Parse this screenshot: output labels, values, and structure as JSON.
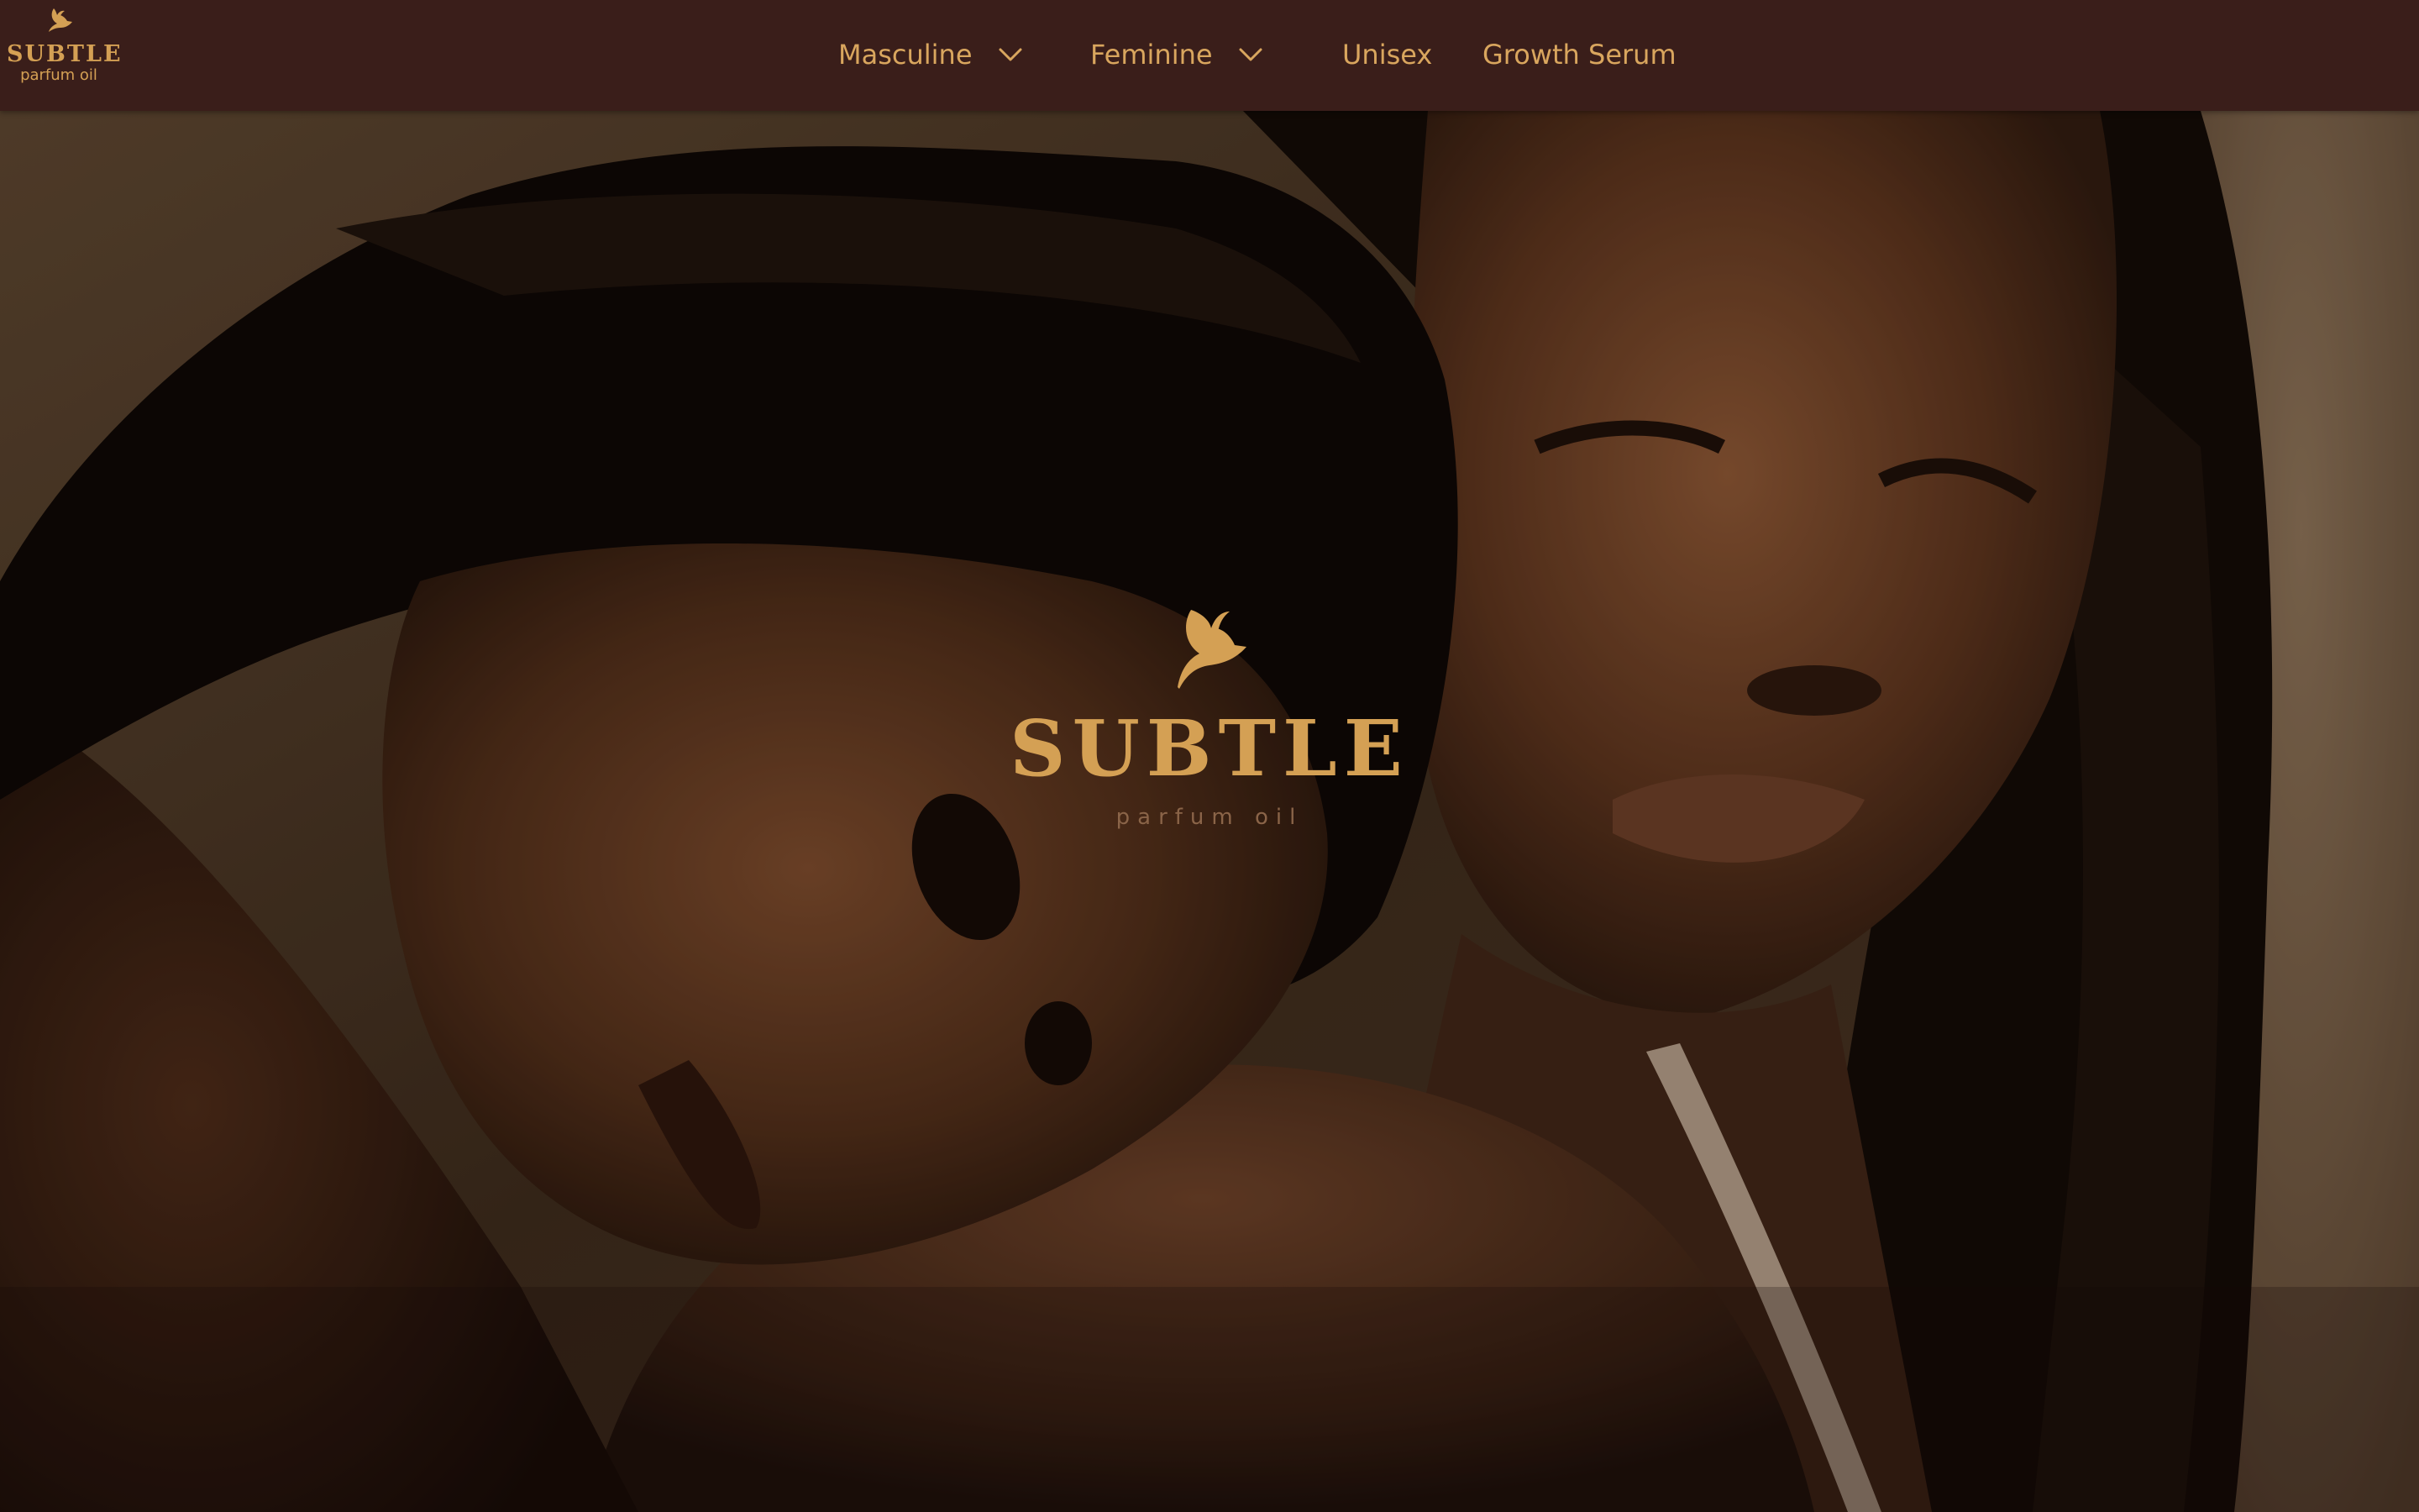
{
  "brand": {
    "name": "SUBTLE",
    "tagline": "parfum oil",
    "logo_icon": "bird-icon"
  },
  "nav": {
    "items": [
      {
        "label": "Masculine",
        "has_dropdown": true
      },
      {
        "label": "Feminine",
        "has_dropdown": true
      },
      {
        "label": "Unisex",
        "has_dropdown": false
      },
      {
        "label": "Growth Serum",
        "has_dropdown": false
      }
    ]
  },
  "hero": {
    "title": "SUBTLE",
    "subtitle": "parfum oil",
    "logo_icon": "bird-icon"
  },
  "colors": {
    "header_bg": "#3a1e1a",
    "accent_gold": "#d4a054",
    "subtitle_brown": "#8a6448"
  }
}
